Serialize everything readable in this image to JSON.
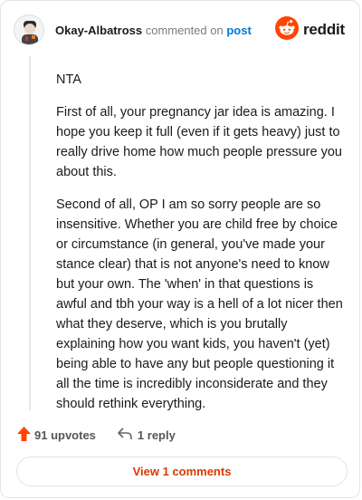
{
  "header": {
    "author": "Okay-Albatross",
    "action": "commented on",
    "post_link": "post",
    "brand": "reddit"
  },
  "comment": {
    "paragraphs": [
      "NTA",
      "First of all, your pregnancy jar idea is amazing. I hope you keep it full (even if it gets heavy) just to really drive home how much people pressure you about this.",
      "Second of all, OP I am so sorry people are so insensitive. Whether you are child free by choice or circumstance (in general, you've made your stance clear) that is not anyone's need to know but your own. The 'when' in that questions is awful and tbh your way is a hell of a lot nicer then what they deserve, which is you brutally explaining how you want kids, you haven't (yet) being able to have any but people questioning it all the time is incredibly inconsiderate and they should rethink everything."
    ]
  },
  "footer": {
    "upvotes": "91 upvotes",
    "replies": "1 reply",
    "view_comments": "View 1 comments"
  },
  "colors": {
    "accent": "#ff4500",
    "link": "#0079d3",
    "view_button": "#d93a00"
  }
}
